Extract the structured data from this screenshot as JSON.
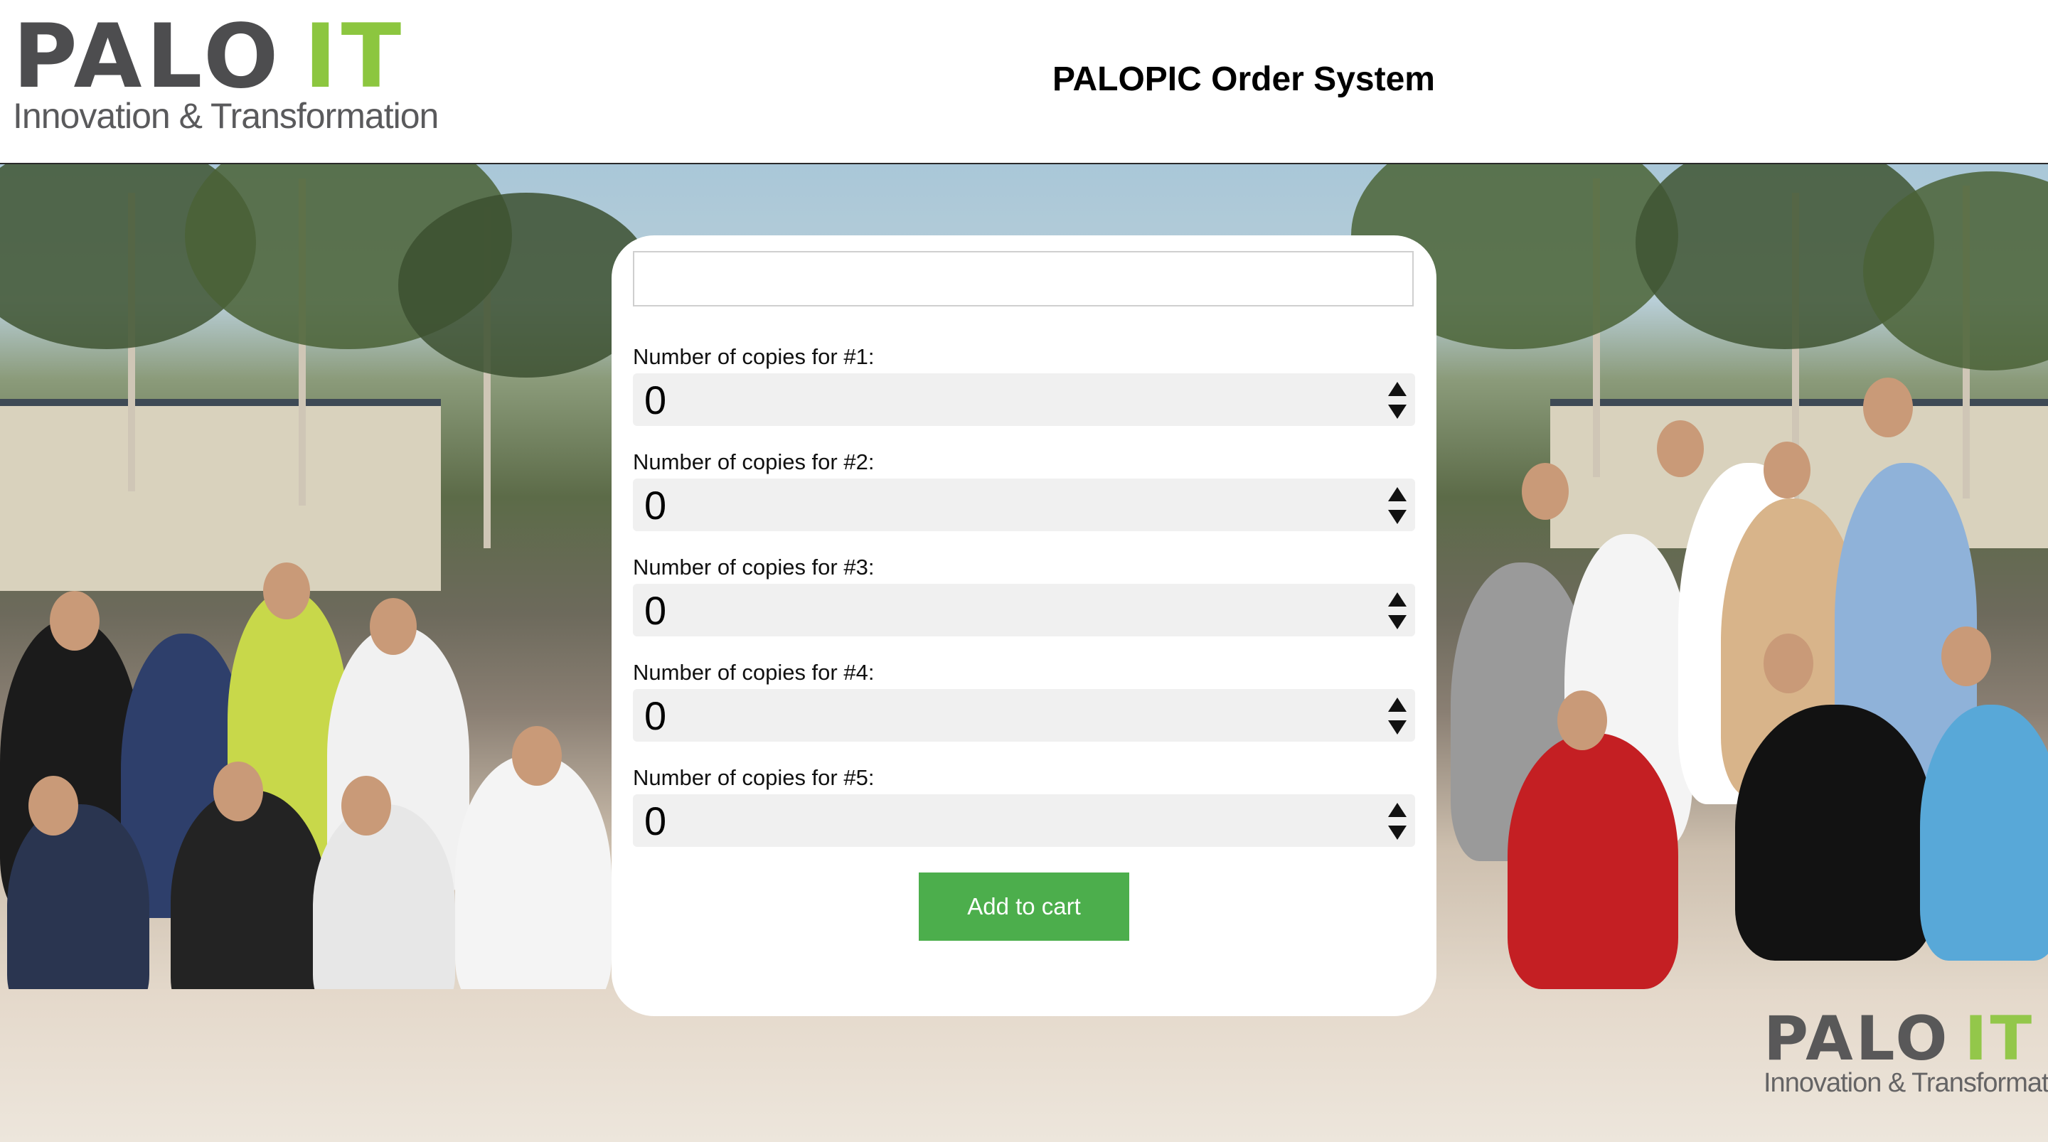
{
  "header": {
    "logo": {
      "word": "PALO",
      "accent": "IT",
      "tagline": "Innovation & Transformation"
    },
    "title": "PALOPIC Order System"
  },
  "watermark": {
    "word": "PALO",
    "accent": "IT",
    "tagline": "Innovation & Transformation"
  },
  "form": {
    "top_field_value": "",
    "quantities": [
      {
        "label": "Number of copies for #1:",
        "value": "0"
      },
      {
        "label": "Number of copies for #2:",
        "value": "0"
      },
      {
        "label": "Number of copies for #3:",
        "value": "0"
      },
      {
        "label": "Number of copies for #4:",
        "value": "0"
      },
      {
        "label": "Number of copies for #5:",
        "value": "0"
      }
    ],
    "add_button_label": "Add to cart"
  },
  "colors": {
    "brand_gray": "#4d4d4f",
    "brand_green": "#8cc63f",
    "button_green": "#4cae4c",
    "input_bg": "#f0f0f0"
  }
}
